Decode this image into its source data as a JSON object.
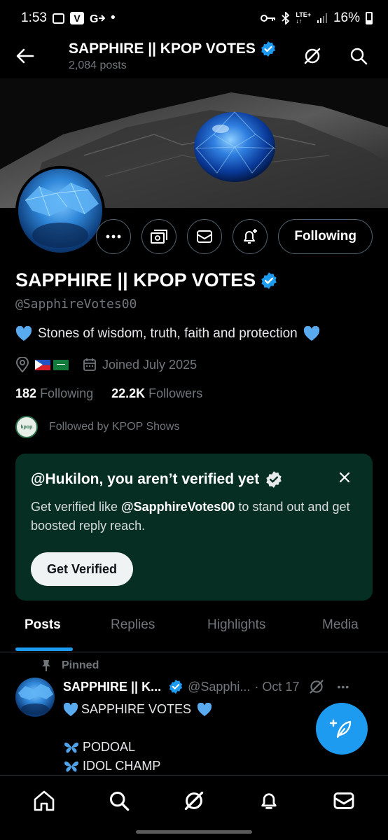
{
  "status_bar": {
    "time": "1:53",
    "dot": "•",
    "lte": "LTE+",
    "battery": "16%"
  },
  "header": {
    "title": "SAPPHIRE || KPOP VOTES",
    "posts_count": "2,084 posts",
    "icons": [
      "back-arrow-icon",
      "grok-icon",
      "search-icon"
    ]
  },
  "profile": {
    "name": "SAPPHIRE || KPOP VOTES",
    "handle": "@SapphireVotes00",
    "bio": "Stones of wisdom, truth, faith and protection",
    "joined": "Joined July 2025",
    "following_count": "182",
    "following_label": "Following",
    "followers_count": "22.2K",
    "followers_label": "Followers",
    "followed_by": "Followed by KPOP Shows",
    "follow_button": "Following",
    "mini_avatar_text": "kpop"
  },
  "verify_card": {
    "title": "@Hukilon, you aren’t verified yet",
    "body_pre": "Get verified like ",
    "body_handle": "@SapphireVotes00",
    "body_post": " to stand out and get boosted reply reach.",
    "button": "Get Verified"
  },
  "tabs": [
    {
      "label": "Posts",
      "active": true
    },
    {
      "label": "Replies",
      "active": false
    },
    {
      "label": "Highlights",
      "active": false
    },
    {
      "label": "Media",
      "active": false
    }
  ],
  "post": {
    "pinned_label": "Pinned",
    "author_name": "SAPPHIRE || K...",
    "author_handle": "@Sapphi...",
    "date": "· Oct 17",
    "more": "•••",
    "lines": [
      "SAPPHIRE VOTES",
      "PODOAL",
      "IDOL CHAMP"
    ]
  },
  "colors": {
    "accent": "#1d9bf0",
    "card_bg": "#072e22",
    "muted": "#71767b",
    "border": "#2f3336"
  }
}
